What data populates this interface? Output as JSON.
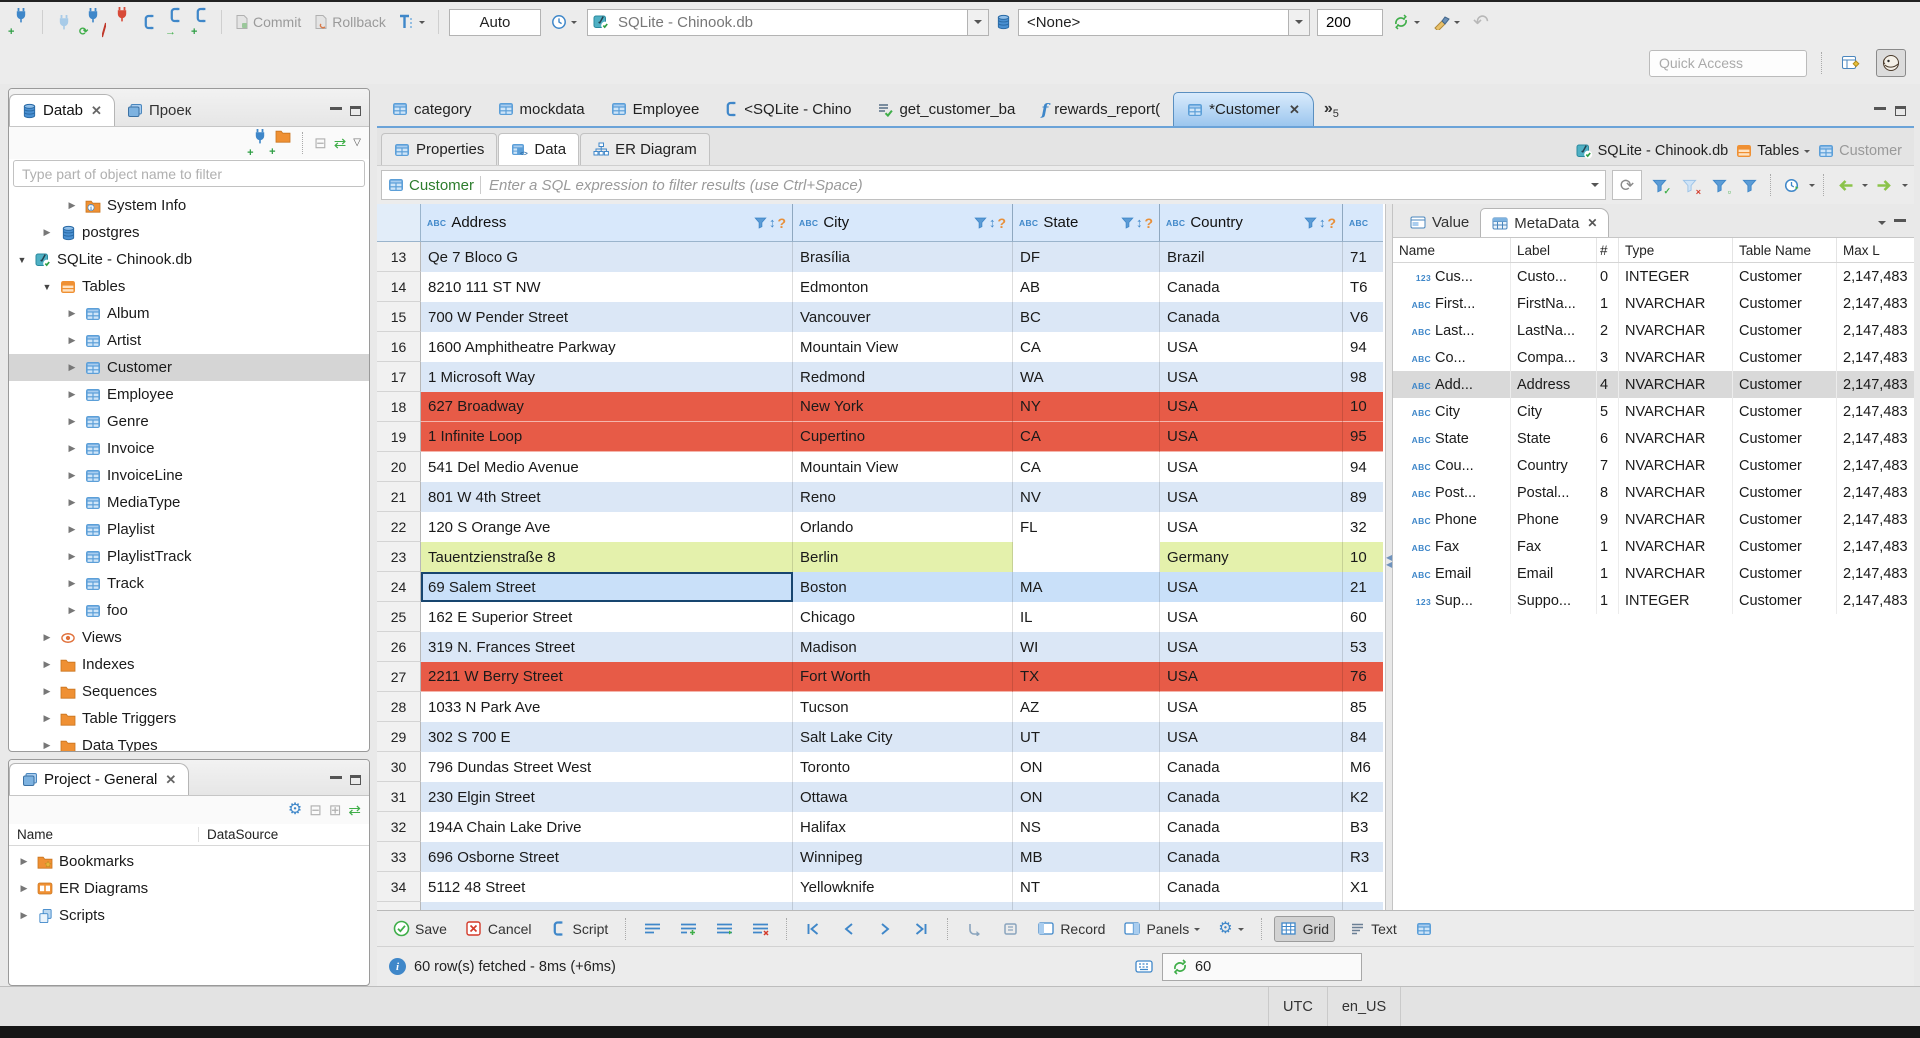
{
  "toolbar": {
    "commit": "Commit",
    "rollback": "Rollback",
    "auto": "Auto",
    "connection": "SQLite - Chinook.db",
    "schema": "<None>",
    "fetch_size": "200",
    "quick_access_placeholder": "Quick Access"
  },
  "sidebar": {
    "tabs": [
      {
        "label": "Datab",
        "closable": true,
        "active": true
      },
      {
        "label": "Проек"
      }
    ],
    "filter_placeholder": "Type part of object name to filter",
    "tree": [
      {
        "label": "System Info",
        "icon": "folder-info",
        "level": 2,
        "expanded": false
      },
      {
        "label": "postgres",
        "icon": "db",
        "level": 1,
        "expanded": false
      },
      {
        "label": "SQLite - Chinook.db",
        "icon": "db-check",
        "level": 0,
        "expanded": true
      },
      {
        "label": "Tables",
        "icon": "table-orange",
        "level": 1,
        "expanded": true
      },
      {
        "label": "Album",
        "icon": "table",
        "level": 2,
        "expanded": false
      },
      {
        "label": "Artist",
        "icon": "table",
        "level": 2,
        "expanded": false
      },
      {
        "label": "Customer",
        "icon": "table",
        "level": 2,
        "expanded": false,
        "selected": true
      },
      {
        "label": "Employee",
        "icon": "table",
        "level": 2,
        "expanded": false
      },
      {
        "label": "Genre",
        "icon": "table",
        "level": 2,
        "expanded": false
      },
      {
        "label": "Invoice",
        "icon": "table",
        "level": 2,
        "expanded": false
      },
      {
        "label": "InvoiceLine",
        "icon": "table",
        "level": 2,
        "expanded": false
      },
      {
        "label": "MediaType",
        "icon": "table",
        "level": 2,
        "expanded": false
      },
      {
        "label": "Playlist",
        "icon": "table",
        "level": 2,
        "expanded": false
      },
      {
        "label": "PlaylistTrack",
        "icon": "table",
        "level": 2,
        "expanded": false
      },
      {
        "label": "Track",
        "icon": "table",
        "level": 2,
        "expanded": false
      },
      {
        "label": "foo",
        "icon": "table",
        "level": 2,
        "expanded": false
      },
      {
        "label": "Views",
        "icon": "eye",
        "level": 1,
        "expanded": false
      },
      {
        "label": "Indexes",
        "icon": "folder",
        "level": 1,
        "expanded": false
      },
      {
        "label": "Sequences",
        "icon": "folder",
        "level": 1,
        "expanded": false
      },
      {
        "label": "Table Triggers",
        "icon": "folder",
        "level": 1,
        "expanded": false
      },
      {
        "label": "Data Types",
        "icon": "folder",
        "level": 1,
        "expanded": false
      }
    ]
  },
  "project_panel": {
    "title": "Project - General",
    "columns": [
      "Name",
      "DataSource"
    ],
    "items": [
      {
        "label": "Bookmarks",
        "icon": "folder-star"
      },
      {
        "label": "ER Diagrams",
        "icon": "erd"
      },
      {
        "label": "Scripts",
        "icon": "scripts"
      }
    ]
  },
  "editor": {
    "tabs": [
      {
        "label": "category",
        "icon": "table"
      },
      {
        "label": "mockdata",
        "icon": "table"
      },
      {
        "label": "Employee",
        "icon": "table"
      },
      {
        "label": "<SQLite - Chino",
        "icon": "sql-page"
      },
      {
        "label": "get_customer_ba",
        "icon": "script-check"
      },
      {
        "label": "rewards_report(",
        "icon": "function"
      },
      {
        "label": "*Customer",
        "icon": "table",
        "active": true,
        "closable": true
      }
    ],
    "overflow_chevron": "»",
    "overflow_count": "5",
    "subtabs": [
      {
        "label": "Properties"
      },
      {
        "label": "Data",
        "active": true
      },
      {
        "label": "ER Diagram"
      }
    ],
    "breadcrumb": {
      "connection": "SQLite - Chinook.db",
      "container": "Tables",
      "entity": "Customer"
    }
  },
  "filter_bar": {
    "entity": "Customer",
    "placeholder": "Enter a SQL expression to filter results (use Ctrl+Space)"
  },
  "grid": {
    "type_badge": "ABC",
    "columns": [
      {
        "label": "Address"
      },
      {
        "label": "City"
      },
      {
        "label": "State"
      },
      {
        "label": "Country"
      },
      {
        "label": ""
      }
    ],
    "rows": [
      {
        "num": "13",
        "cells": [
          "Qe 7 Bloco G",
          "Brasília",
          "DF",
          "Brazil",
          "71"
        ],
        "style": "alt"
      },
      {
        "num": "14",
        "cells": [
          "8210 111 ST NW",
          "Edmonton",
          "AB",
          "Canada",
          "T6"
        ],
        "style": "white"
      },
      {
        "num": "15",
        "cells": [
          "700 W Pender Street",
          "Vancouver",
          "BC",
          "Canada",
          "V6"
        ],
        "style": "alt"
      },
      {
        "num": "16",
        "cells": [
          "1600 Amphitheatre Parkway",
          "Mountain View",
          "CA",
          "USA",
          "94"
        ],
        "style": "white"
      },
      {
        "num": "17",
        "cells": [
          "1 Microsoft Way",
          "Redmond",
          "WA",
          "USA",
          "98"
        ],
        "style": "alt"
      },
      {
        "num": "18",
        "cells": [
          "627 Broadway",
          "New York",
          "NY",
          "USA",
          "10"
        ],
        "style": "red"
      },
      {
        "num": "19",
        "cells": [
          "1 Infinite Loop",
          "Cupertino",
          "CA",
          "USA",
          "95"
        ],
        "style": "red"
      },
      {
        "num": "20",
        "cells": [
          "541 Del Medio Avenue",
          "Mountain View",
          "CA",
          "USA",
          "94"
        ],
        "style": "white"
      },
      {
        "num": "21",
        "cells": [
          "801 W 4th Street",
          "Reno",
          "NV",
          "USA",
          "89"
        ],
        "style": "alt"
      },
      {
        "num": "22",
        "cells": [
          "120 S Orange Ave",
          "Orlando",
          "FL",
          "USA",
          "32"
        ],
        "style": "white"
      },
      {
        "num": "23",
        "cells": [
          "Tauentzienstraße 8",
          "Berlin",
          "",
          "Germany",
          "10"
        ],
        "style": "green",
        "white_cell": 2
      },
      {
        "num": "24",
        "cells": [
          "69 Salem Street",
          "Boston",
          "MA",
          "USA",
          "21"
        ],
        "style": "selected",
        "selected_cell": 0
      },
      {
        "num": "25",
        "cells": [
          "162 E Superior Street",
          "Chicago",
          "IL",
          "USA",
          "60"
        ],
        "style": "white"
      },
      {
        "num": "26",
        "cells": [
          "319 N. Frances Street",
          "Madison",
          "WI",
          "USA",
          "53"
        ],
        "style": "alt"
      },
      {
        "num": "27",
        "cells": [
          "2211 W Berry Street",
          "Fort Worth",
          "TX",
          "USA",
          "76"
        ],
        "style": "red"
      },
      {
        "num": "28",
        "cells": [
          "1033 N Park Ave",
          "Tucson",
          "AZ",
          "USA",
          "85"
        ],
        "style": "white"
      },
      {
        "num": "29",
        "cells": [
          "302 S 700 E",
          "Salt Lake City",
          "UT",
          "USA",
          "84"
        ],
        "style": "alt"
      },
      {
        "num": "30",
        "cells": [
          "796 Dundas Street West",
          "Toronto",
          "ON",
          "Canada",
          "M6"
        ],
        "style": "white"
      },
      {
        "num": "31",
        "cells": [
          "230 Elgin Street",
          "Ottawa",
          "ON",
          "Canada",
          "K2"
        ],
        "style": "alt"
      },
      {
        "num": "32",
        "cells": [
          "194A Chain Lake Drive",
          "Halifax",
          "NS",
          "Canada",
          "B3"
        ],
        "style": "white"
      },
      {
        "num": "33",
        "cells": [
          "696 Osborne Street",
          "Winnipeg",
          "MB",
          "Canada",
          "R3"
        ],
        "style": "alt"
      },
      {
        "num": "34",
        "cells": [
          "5112 48 Street",
          "Yellowknife",
          "NT",
          "Canada",
          "X1"
        ],
        "style": "white"
      }
    ]
  },
  "metadata_panel": {
    "tabs": [
      {
        "label": "Value"
      },
      {
        "label": "MetaData",
        "active": true,
        "closable": true
      }
    ],
    "columns": [
      "Name",
      "Label",
      "#",
      "Type",
      "Table Name",
      "Max L"
    ],
    "rows": [
      {
        "badge": "123",
        "name": "Cus...",
        "label": "Custo...",
        "num": "0",
        "type": "INTEGER",
        "table": "Customer",
        "max": "2,147,483"
      },
      {
        "badge": "ABC",
        "name": "First...",
        "label": "FirstNa...",
        "num": "1",
        "type": "NVARCHAR",
        "table": "Customer",
        "max": "2,147,483"
      },
      {
        "badge": "ABC",
        "name": "Last...",
        "label": "LastNa...",
        "num": "2",
        "type": "NVARCHAR",
        "table": "Customer",
        "max": "2,147,483"
      },
      {
        "badge": "ABC",
        "name": "Co...",
        "label": "Compa...",
        "num": "3",
        "type": "NVARCHAR",
        "table": "Customer",
        "max": "2,147,483"
      },
      {
        "badge": "ABC",
        "name": "Add...",
        "label": "Address",
        "num": "4",
        "type": "NVARCHAR",
        "table": "Customer",
        "max": "2,147,483",
        "selected": true
      },
      {
        "badge": "ABC",
        "name": "City",
        "label": "City",
        "num": "5",
        "type": "NVARCHAR",
        "table": "Customer",
        "max": "2,147,483"
      },
      {
        "badge": "ABC",
        "name": "State",
        "label": "State",
        "num": "6",
        "type": "NVARCHAR",
        "table": "Customer",
        "max": "2,147,483"
      },
      {
        "badge": "ABC",
        "name": "Cou...",
        "label": "Country",
        "num": "7",
        "type": "NVARCHAR",
        "table": "Customer",
        "max": "2,147,483"
      },
      {
        "badge": "ABC",
        "name": "Post...",
        "label": "Postal...",
        "num": "8",
        "type": "NVARCHAR",
        "table": "Customer",
        "max": "2,147,483"
      },
      {
        "badge": "ABC",
        "name": "Phone",
        "label": "Phone",
        "num": "9",
        "type": "NVARCHAR",
        "table": "Customer",
        "max": "2,147,483"
      },
      {
        "badge": "ABC",
        "name": "Fax",
        "label": "Fax",
        "num": "1",
        "type": "NVARCHAR",
        "table": "Customer",
        "max": "2,147,483"
      },
      {
        "badge": "ABC",
        "name": "Email",
        "label": "Email",
        "num": "1",
        "type": "NVARCHAR",
        "table": "Customer",
        "max": "2,147,483"
      },
      {
        "badge": "123",
        "name": "Sup...",
        "label": "Suppo...",
        "num": "1",
        "type": "INTEGER",
        "table": "Customer",
        "max": "2,147,483"
      }
    ]
  },
  "result_toolbar": {
    "save": "Save",
    "cancel": "Cancel",
    "script": "Script",
    "record": "Record",
    "panels": "Panels",
    "grid": "Grid",
    "text": "Text"
  },
  "status_bar": {
    "message": "60 row(s) fetched - 8ms (+6ms)",
    "refresh_count": "60"
  },
  "bottom_bar": {
    "timezone": "UTC",
    "locale": "en_US"
  },
  "colors": {
    "accent_blue": "#3f87c9",
    "row_alt": "#dbe7f6",
    "row_error_red": "#e75b47",
    "row_new_green": "#e4f1ac",
    "row_selected": "#c9e0f9",
    "grid_header_bg": "#d8e8fb"
  }
}
